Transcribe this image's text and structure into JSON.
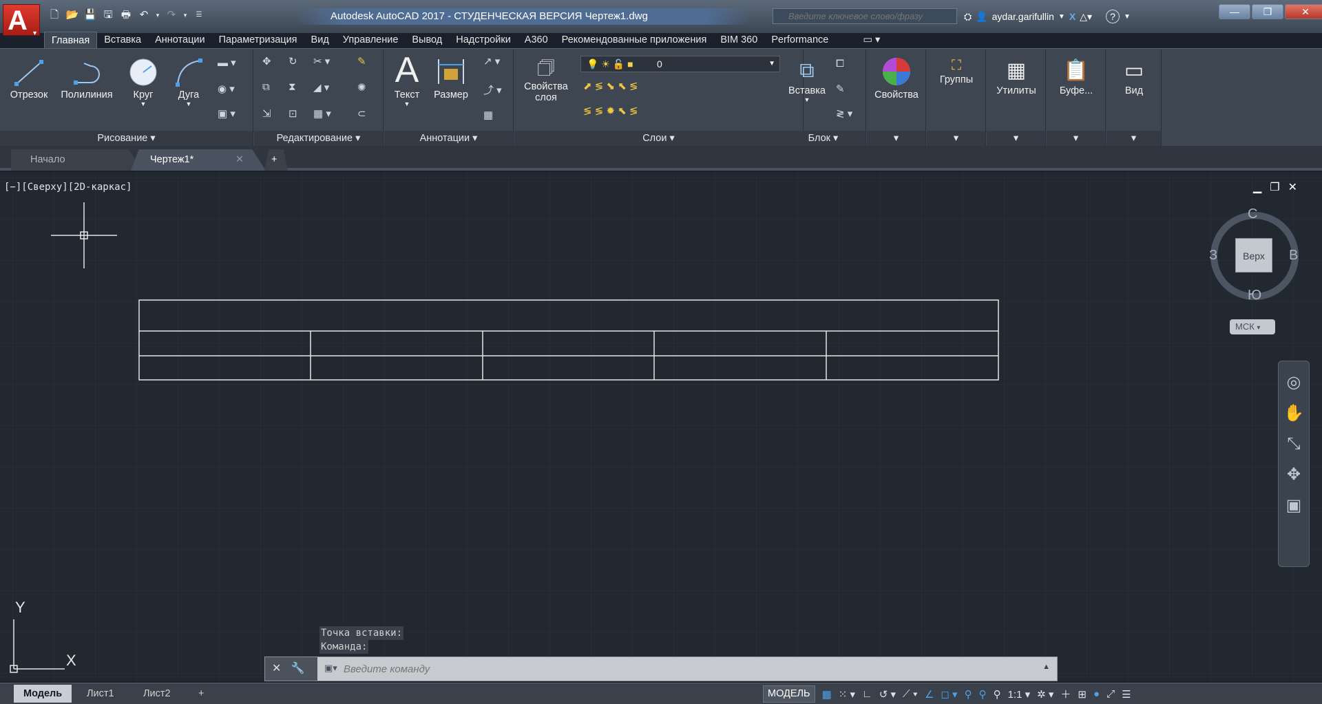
{
  "titlebar": {
    "app_letter": "A",
    "title": "Autodesk AutoCAD 2017 - СТУДЕНЧЕСКАЯ ВЕРСИЯ    Чертеж1.dwg",
    "search_placeholder": "Введите ключевое слово/фразу",
    "user": "aydar.garifullin",
    "help": "?"
  },
  "ribbon_tabs": [
    "Главная",
    "Вставка",
    "Аннотации",
    "Параметризация",
    "Вид",
    "Управление",
    "Вывод",
    "Надстройки",
    "A360",
    "Рекомендованные приложения",
    "BIM 360",
    "Performance"
  ],
  "panels": {
    "draw": {
      "title": "Рисование ▾",
      "tools": [
        "Отрезок",
        "Полилиния",
        "Круг",
        "Дуга"
      ]
    },
    "modify": {
      "title": "Редактирование ▾"
    },
    "annotation": {
      "title": "Аннотации ▾",
      "tools": [
        "Текст",
        "Размер"
      ]
    },
    "layers": {
      "title": "Слои ▾",
      "props_label_1": "Свойства",
      "props_label_2": "слоя",
      "current_layer": "0"
    },
    "block": {
      "title": "Блок ▾",
      "insert": "Вставка"
    },
    "properties": {
      "label": "Свойства"
    },
    "groups": {
      "label": "Группы"
    },
    "utilities": {
      "label": "Утилиты"
    },
    "clipboard": {
      "label": "Буфе..."
    },
    "view": {
      "label": "Вид"
    }
  },
  "doc_tabs": {
    "start": "Начало",
    "drawing": "Чертеж1*",
    "add": "+"
  },
  "viewport": {
    "label": "[−][Сверху][2D-каркас]",
    "viewcube": {
      "n": "С",
      "s": "Ю",
      "w": "З",
      "e": "В",
      "face": "Верх",
      "ucs": "МСК"
    },
    "axis_y": "Y",
    "axis_x": "X"
  },
  "command": {
    "history": [
      "Точка вставки:",
      "Команда:"
    ],
    "placeholder": "Введите команду"
  },
  "layout_tabs": [
    "Модель",
    "Лист1",
    "Лист2",
    "+"
  ],
  "status": {
    "model": "МОДЕЛЬ",
    "scale": "1:1 ▾"
  }
}
